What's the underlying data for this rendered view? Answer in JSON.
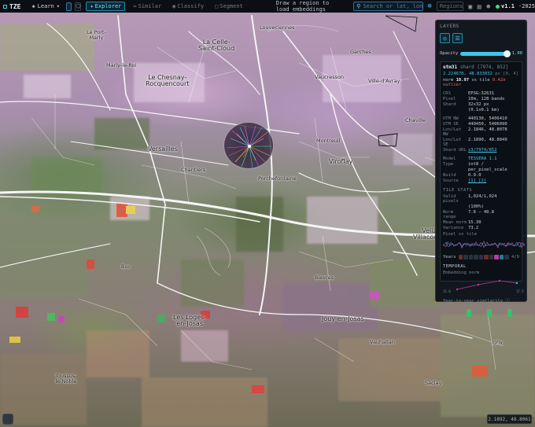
{
  "topbar": {
    "logo": "TZE",
    "learn_label": "Learn",
    "modes": [
      {
        "label": "Explorer",
        "active": true
      },
      {
        "label": "Similar",
        "active": false
      },
      {
        "label": "Classify",
        "active": false
      },
      {
        "label": "Segment",
        "active": false
      }
    ],
    "hint": "Draw a region to load embeddings",
    "search_placeholder": "Search or lat, lon...",
    "regions_label": "Regions",
    "version": "v1.1",
    "year": "2025"
  },
  "map": {
    "places": [
      {
        "name": "Le Port-\nMarly",
        "big": false
      },
      {
        "name": "Louveciennes",
        "big": false
      },
      {
        "name": "Marly-le-Roi",
        "big": false
      },
      {
        "name": "La Celle-\nSaint-Cloud",
        "big": true
      },
      {
        "name": "Le Chesnay-\nRocquencourt",
        "big": true
      },
      {
        "name": "Garches",
        "big": false
      },
      {
        "name": "Vaucresson",
        "big": false
      },
      {
        "name": "Ville-d'Avray",
        "big": false
      },
      {
        "name": "Versailles",
        "big": true
      },
      {
        "name": "Viroflay",
        "big": true
      },
      {
        "name": "Montreuil",
        "big": false
      },
      {
        "name": "Porchefontaine",
        "big": false
      },
      {
        "name": "Chantiers",
        "big": false
      },
      {
        "name": "Velizy-\nVillacoublay",
        "big": true
      },
      {
        "name": "Buc",
        "big": false
      },
      {
        "name": "Les Loges-\nen-Josas",
        "big": true
      },
      {
        "name": "Jouy-en-Josas",
        "big": true
      },
      {
        "name": "Toussus-\nle-Noble",
        "big": false
      },
      {
        "name": "Saclay",
        "big": false
      },
      {
        "name": "Bievres",
        "big": false
      },
      {
        "name": "Vauhallan",
        "big": false
      },
      {
        "name": "Igny",
        "big": false
      },
      {
        "name": "Chaville",
        "big": false
      }
    ]
  },
  "panel": {
    "title": "LAYERS",
    "opacity_label": "Opacity",
    "opacity_value": "1.00",
    "opacity_fraction": 0.95,
    "shard_name": "utm31",
    "shard_suffix": "shard [7974, 852]",
    "coord": "2.224678, 48.833032",
    "coord_suffix": "px [0, 4]",
    "norm_prefix": "norm",
    "norm_value": "10.97",
    "norm_mid": "vs tile",
    "norm_outlier": "0.42σ outlier",
    "rows1": [
      {
        "k": "CRS",
        "v": "EPSG:32631",
        "cls": ""
      },
      {
        "k": "Pixel",
        "v": "10m, 128 bands",
        "cls": ""
      },
      {
        "k": "Shard",
        "v": "32x32 px",
        "cls": ""
      },
      {
        "k": "",
        "v": "(0.1x0.1 km)",
        "cls": ""
      }
    ],
    "rows2": [
      {
        "k": "UTM NW",
        "v": "440130, 5406410",
        "cls": ""
      },
      {
        "k": "UTM SE",
        "v": "440450, 5406090",
        "cls": ""
      },
      {
        "k": "Lon/Lat NW",
        "v": "2.1846, 48.8078",
        "cls": ""
      },
      {
        "k": "Lon/Lat SE",
        "v": "2.1890, 48.8049",
        "cls": ""
      },
      {
        "k": "Shard URL",
        "v": "s3/7974/852",
        "cls": "link"
      }
    ],
    "rows3": [
      {
        "k": "Model",
        "v": "TESSERA 1.1",
        "cls": "acc"
      },
      {
        "k": "Type",
        "v": "int8 /",
        "cls": ""
      },
      {
        "k": "",
        "v": "per_pixel_scale",
        "cls": ""
      },
      {
        "k": "Build",
        "v": "0.9.0",
        "cls": ""
      },
      {
        "k": "Source",
        "v": "[1] [2]",
        "cls": "link"
      }
    ],
    "tile_state_title": "TILE STATS",
    "rows4": [
      {
        "k": "Valid pixels",
        "v": "1,024/1,024",
        "cls": ""
      },
      {
        "k": "",
        "v": "(100%)",
        "cls": ""
      },
      {
        "k": "Norm range",
        "v": "7.6 — 40.8",
        "cls": ""
      },
      {
        "k": "Mean norm",
        "v": "15.30",
        "cls": ""
      },
      {
        "k": "Variance",
        "v": "73.2",
        "cls": ""
      }
    ],
    "pixel_to_tile": "Pixel vs tile",
    "years_label": "Years",
    "years_count": "4/9",
    "temporal_title": "TEMPORAL",
    "embedding_norm": "Embedding norm",
    "temporal_min": "15.0",
    "temporal_max": "17.5",
    "yoy_label": "Year-to-year similarity",
    "colors": {
      "accent": "#3fc7e8",
      "outlier": "#f0644f",
      "bars": "#3ac06a",
      "line": "#c0399a"
    }
  },
  "bottom": {
    "coord_readout": "2.1892, 48.8061"
  }
}
